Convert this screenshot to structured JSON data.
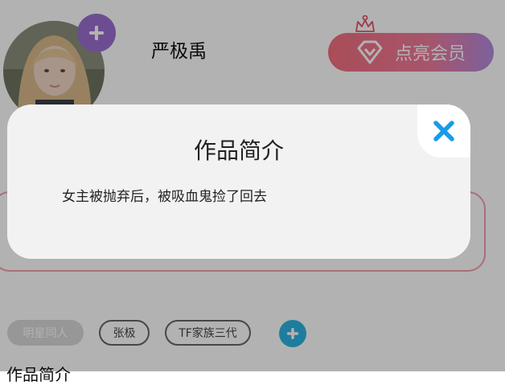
{
  "profile": {
    "username": "严极禹",
    "vip_button_label": "点亮会员"
  },
  "tags": [
    "明星同人",
    "张极",
    "TF家族三代"
  ],
  "section": {
    "title": "作品简介"
  },
  "dialog": {
    "title": "作品简介",
    "body": "女主被抛弃后，被吸血鬼捡了回去"
  },
  "colors": {
    "add_avatar": "#9b6fd0",
    "vip_gradient_start": "#f26f7f",
    "vip_gradient_end": "#b18be0",
    "add_tag": "#2bb3e3",
    "close_icon": "#1a9be8",
    "intro_border": "#f2a0ae"
  },
  "icons": {
    "add_avatar": "plus-icon",
    "crown": "crown-icon",
    "vip": "diamond-icon",
    "add_tag": "plus-icon",
    "close": "close-icon"
  }
}
